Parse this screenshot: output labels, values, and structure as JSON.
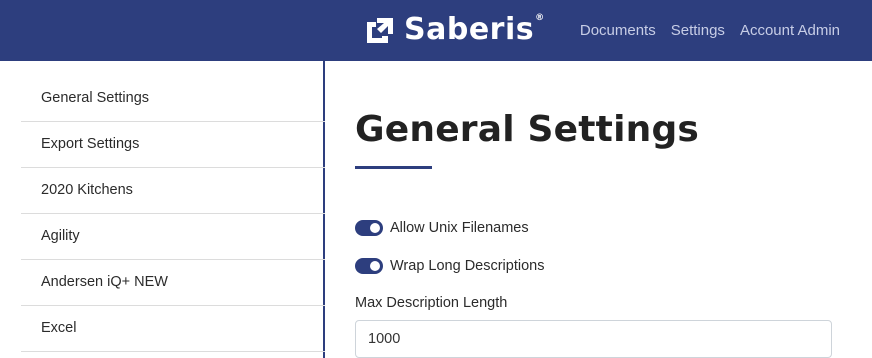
{
  "header": {
    "brand": "Saberis",
    "brand_mark": "®",
    "nav": [
      "Documents",
      "Settings",
      "Account Admin"
    ],
    "colors": {
      "bar": "#2d3e7e",
      "nav_text": "#c7cde6"
    }
  },
  "sidebar": {
    "items": [
      "General Settings",
      "Export Settings",
      "2020 Kitchens",
      "Agility",
      "Andersen iQ+ NEW",
      "Excel"
    ]
  },
  "main": {
    "title": "General Settings",
    "toggles": [
      {
        "label": "Allow Unix Filenames",
        "on": true
      },
      {
        "label": "Wrap Long Descriptions",
        "on": true
      }
    ],
    "max_description": {
      "label": "Max Description Length",
      "value": "1000"
    }
  }
}
